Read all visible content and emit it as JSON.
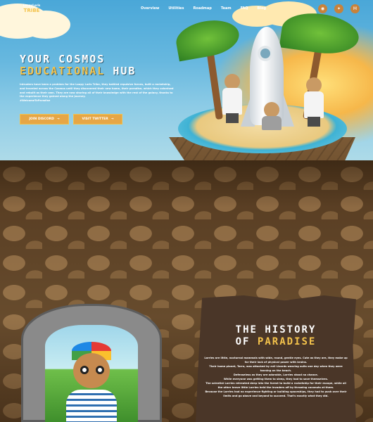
{
  "nav": {
    "logo_line1": "LoopyLoris",
    "logo_line2": "TRIBE",
    "items": [
      {
        "label": "Overview"
      },
      {
        "label": "Utilities"
      },
      {
        "label": "Roadmap"
      },
      {
        "label": "Team"
      },
      {
        "label": "FAQ"
      },
      {
        "label": "Blog"
      }
    ],
    "socials": [
      {
        "icon": "discord-icon",
        "glyph": "◉"
      },
      {
        "icon": "twitter-icon",
        "glyph": "✦"
      },
      {
        "icon": "medium-icon",
        "glyph": "M"
      }
    ]
  },
  "hero": {
    "title_line1": "YOUR COSMOS",
    "title_line2_gold": "EDUCATIONAL",
    "title_line2_rest": " HUB",
    "intro": "Intruders have been a problem for the Loopy Loris Tribe, they battled repulsive forces, built a rocketship, and traveled across the Cosmos until they discovered their new home, their paradise, which they colonised and rebuilt as their own. They are now sharing all of their knowledge with the rest of the galaxy, thanks to the experience they gained along the journey.",
    "hashtag": "#WelcomeToParadise",
    "buttons": [
      {
        "label": "JOIN DISCORD",
        "arrow": "→"
      },
      {
        "label": "VISIT TWITTER",
        "arrow": "→"
      }
    ]
  },
  "history": {
    "title_line1": "THE HISTORY",
    "title_line2_plain": "OF ",
    "title_line2_gold": "PARADISE",
    "paragraphs": [
      "Lorries are little, nocturnal mammals with wide, round, gentle eyes. Cute as they are, they make up for their lack of physical power with brains.",
      "Their home planet, Torra, was attacked by evil Lizards wearing suits one day when they were tanning on the beach.",
      "Defenseless as they are adorable, Lorries stood no chance.",
      "While everyone was getting them to sleep, they had to save themselves.",
      "The scientist Lorries retreated deep into the forest to build a rocketship for their escape, while all the other brave little Lorries held the invaders off by throwing coconuts at them.",
      "Because the Lorries had no experience fighting or building spaceships, they had to push over their limits and go above and beyond to succeed. That's exactly what they did."
    ]
  },
  "colors": {
    "gold": "#f3c24b",
    "button": "#e6a645",
    "sky": "#67b8df",
    "rock": "#5a3f24"
  }
}
